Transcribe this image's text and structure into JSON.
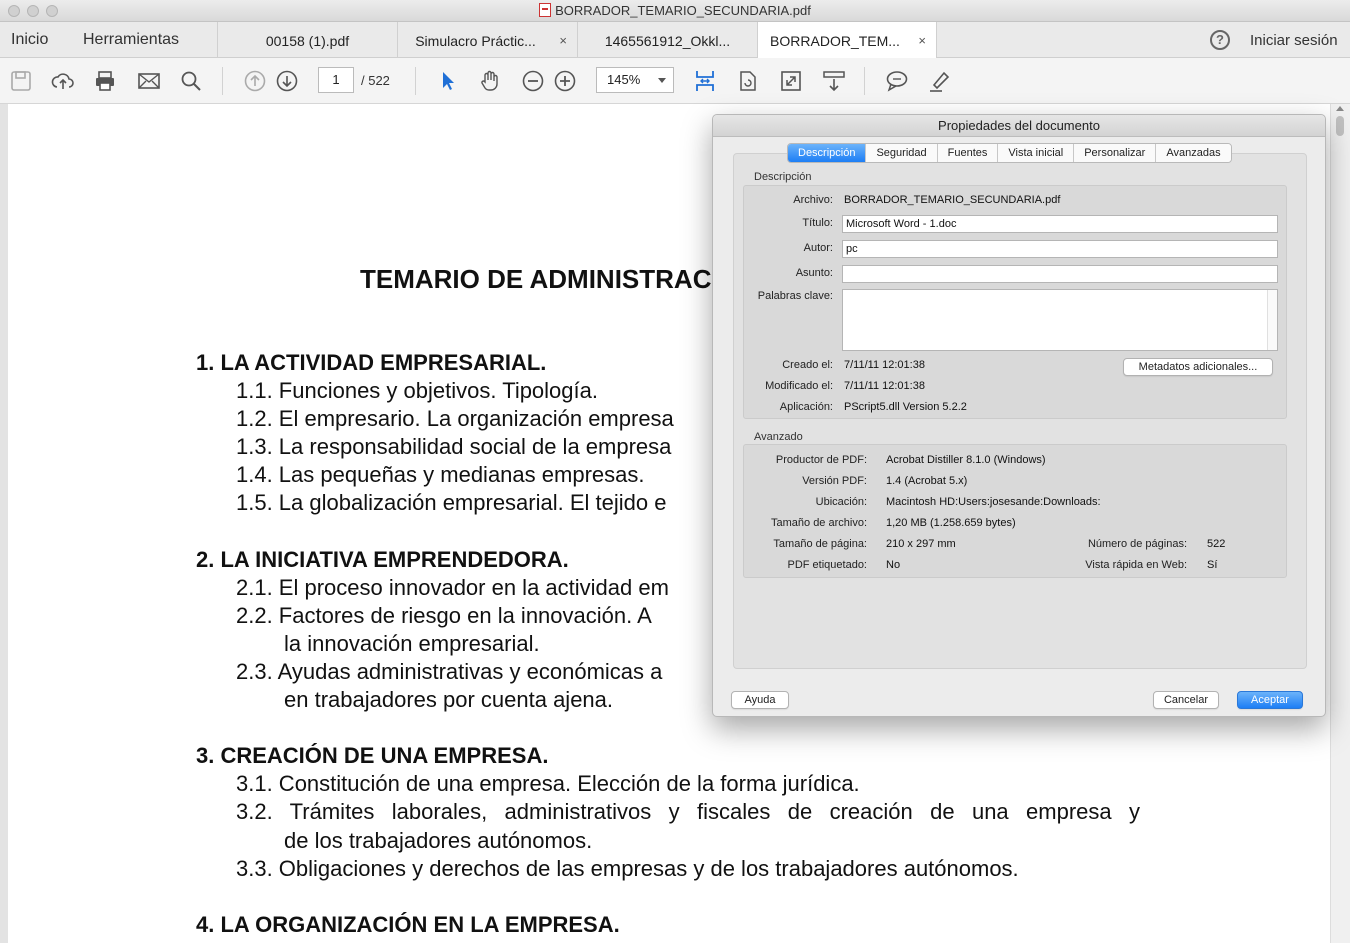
{
  "window": {
    "title": "BORRADOR_TEMARIO_SECUNDARIA.pdf"
  },
  "nav": {
    "home": "Inicio",
    "tools": "Herramientas",
    "signin": "Iniciar sesión",
    "help_glyph": "?"
  },
  "tabs": [
    {
      "label": "00158 (1).pdf",
      "closable": false
    },
    {
      "label": "Simulacro Práctic...",
      "closable": true
    },
    {
      "label": "1465561912_Okkl...",
      "closable": false
    },
    {
      "label": "BORRADOR_TEM...",
      "closable": true,
      "active": true
    }
  ],
  "tab_close_glyph": "×",
  "toolbar": {
    "icons": [
      "save-icon",
      "upload-icon",
      "print-icon",
      "mail-icon",
      "search-icon",
      "page-up-icon",
      "page-down-icon",
      "select-pointer-icon",
      "hand-icon",
      "zoom-out-icon",
      "zoom-in-icon",
      "fit-width-icon",
      "rotate-icon",
      "fullscreen-icon",
      "scroll-mode-icon",
      "comment-icon",
      "highlight-icon"
    ],
    "current_page": "1",
    "page_total": "/ 522",
    "zoom": "145%"
  },
  "document": {
    "title": "TEMARIO DE ADMINISTRAC",
    "lines": [
      {
        "text": "1.   LA ACTIVIDAD EMPRESARIAL.",
        "heading": true
      },
      {
        "text": "1.1. Funciones y objetivos. Tipología.",
        "heading": false
      },
      {
        "text": "1.2. El empresario. La organización empresa",
        "heading": false
      },
      {
        "text": "1.3. La responsabilidad social de la empresa",
        "heading": false
      },
      {
        "text": "1.4. Las pequeñas y medianas empresas.",
        "heading": false
      },
      {
        "text": "1.5. La globalización empresarial. El tejido e",
        "heading": false
      },
      {
        "text": "2.   LA INICIATIVA EMPRENDEDORA.",
        "heading": true
      },
      {
        "text": "2.1. El proceso innovador en la actividad em",
        "heading": false
      },
      {
        "text": "2.2. Factores de riesgo en la innovación. A",
        "heading": false
      },
      {
        "text": "la innovación empresarial.",
        "heading": false,
        "indent": true
      },
      {
        "text": "2.3. Ayudas administrativas y económicas a",
        "heading": false
      },
      {
        "text": "en trabajadores por cuenta ajena.",
        "heading": false,
        "indent": true
      },
      {
        "text": "3.   CREACIÓN DE UNA EMPRESA.",
        "heading": true
      },
      {
        "text": "3.1. Constitución de una empresa. Elección de la forma jurídica.",
        "heading": false
      },
      {
        "text": "3.2.  Trámites laborales, administrativos y fiscales de creación de una empresa y",
        "heading": false
      },
      {
        "text": "de los trabajadores autónomos.",
        "heading": false,
        "indent": true
      },
      {
        "text": "3.3. Obligaciones y derechos de las empresas y de los trabajadores autónomos.",
        "heading": false
      },
      {
        "text": "4.   LA ORGANIZACIÓN EN LA EMPRESA.",
        "heading": true
      }
    ]
  },
  "dialog": {
    "title": "Propiedades del documento",
    "tabs": [
      "Descripción",
      "Seguridad",
      "Fuentes",
      "Vista inicial",
      "Personalizar",
      "Avanzadas"
    ],
    "selected_tab": "Descripción",
    "description": {
      "section_label": "Descripción",
      "archivo_label": "Archivo:",
      "archivo": "BORRADOR_TEMARIO_SECUNDARIA.pdf",
      "titulo_label": "Título:",
      "titulo": "Microsoft Word - 1.doc",
      "autor_label": "Autor:",
      "autor": "pc",
      "asunto_label": "Asunto:",
      "asunto": "",
      "palabras_label": "Palabras clave:",
      "palabras": "",
      "creado_label": "Creado el:",
      "creado": "7/11/11 12:01:38",
      "modificado_label": "Modificado el:",
      "modificado": "7/11/11 12:01:38",
      "aplicacion_label": "Aplicación:",
      "aplicacion": "PScript5.dll Version 5.2.2",
      "metadata_button": "Metadatos adicionales..."
    },
    "advanced": {
      "section_label": "Avanzado",
      "productor_label": "Productor de PDF:",
      "productor": "Acrobat Distiller 8.1.0 (Windows)",
      "version_label": "Versión PDF:",
      "version": "1.4 (Acrobat 5.x)",
      "ubicacion_label": "Ubicación:",
      "ubicacion": "Macintosh HD:Users:josesande:Downloads:",
      "tamano_archivo_label": "Tamaño de archivo:",
      "tamano_archivo": "1,20 MB (1.258.659 bytes)",
      "tamano_pagina_label": "Tamaño de página:",
      "tamano_pagina": "210 x 297 mm",
      "num_paginas_label": "Número de páginas:",
      "num_paginas": "522",
      "etiquetado_label": "PDF etiquetado:",
      "etiquetado": "No",
      "vista_rapida_label": "Vista rápida en Web:",
      "vista_rapida": "Sí"
    },
    "buttons": {
      "help": "Ayuda",
      "cancel": "Cancelar",
      "ok": "Aceptar"
    }
  }
}
